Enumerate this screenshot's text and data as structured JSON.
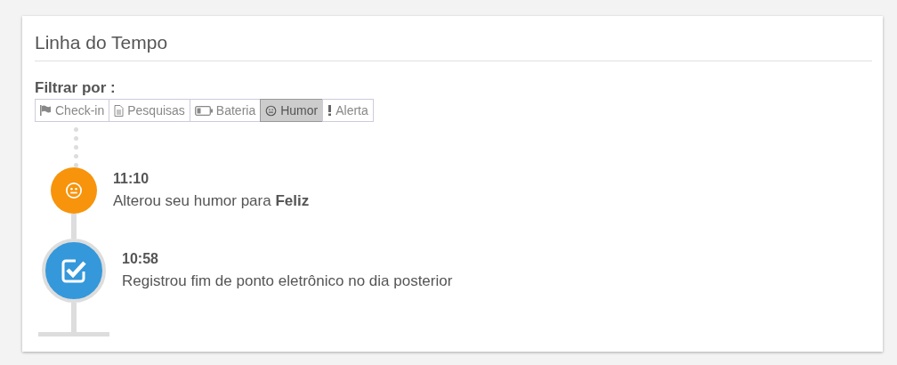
{
  "panel": {
    "title": "Linha do Tempo"
  },
  "filter": {
    "label": "Filtrar por :",
    "options": [
      {
        "kind": "checkin",
        "label": "Check-in",
        "selected": false
      },
      {
        "kind": "survey",
        "label": "Pesquisas",
        "selected": false
      },
      {
        "kind": "battery",
        "label": "Bateria",
        "selected": false
      },
      {
        "kind": "mood",
        "label": "Humor",
        "selected": true
      },
      {
        "kind": "alert",
        "label": "Alerta",
        "selected": false
      }
    ]
  },
  "timeline": [
    {
      "kind": "mood",
      "time": "11:10",
      "text": "Alterou seu humor para **Feliz**"
    },
    {
      "kind": "check",
      "time": "10:58",
      "text": "Registrou fim de ponto eletrônico no dia posterior"
    }
  ]
}
